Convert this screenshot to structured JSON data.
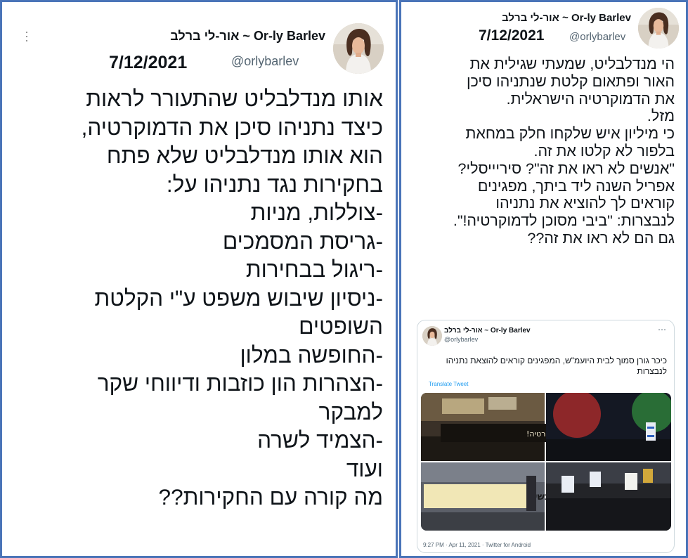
{
  "left_tweet": {
    "author_name": "אור-לי ברלב ~ Or-ly Barlev",
    "handle": "@orlybarlev",
    "date": "7/12/2021",
    "lines": [
      "אותו מנדלבליט שהתעורר לראות",
      "כיצד נתניהו סיכן את הדמוקרטיה,",
      "הוא אותו מנדלבליט שלא פתח",
      "בחקירות נגד נתניהו על:",
      "-צוללות, מניות",
      "-גריסת המסמכים",
      "-ריגול בבחירות",
      "-ניסיון שיבוש משפט ע\"י הקלטת",
      "השופטים",
      "-החופשה במלון",
      "-הצהרות הון כוזבות ודיווחי שקר",
      "למבקר",
      "-הצמיד לשרה",
      "ועוד",
      "מה קורה עם החקירות??"
    ]
  },
  "right_tweet": {
    "author_name": "אור-לי ברלב ~ Or-ly Barlev",
    "handle": "@orlybarlev",
    "date": "7/12/2021",
    "lines": [
      "הי מנדלבליט, שמעתי שגילית את",
      "האור ופתאום קלטת שנתניהו סיכן",
      "את הדמוקרטיה הישראלית.",
      "מזל.",
      "כי מיליון איש שלקחו חלק במחאת",
      "בלפור לא קלטו את זה.",
      "\"אנשים לא ראו את זה\"? סיריייסלי?",
      "אפריל השנה ליד ביתך, מפגינים",
      "קוראים לך להוציא את נתניהו",
      "לנבצרות: \"ביבי מסוכן לדמוקרטיה!\".",
      "גם הם לא ראו את זה??"
    ],
    "quoted": {
      "author_name": "אור-לי ברלב ~ Or-ly Barlev",
      "handle": "@orlybarlev",
      "text": "כיכר גורן סמוך לבית היועמ\"ש, המפגינים קוראים להוצאת נתניהו לנבצרות",
      "translate_label": "Translate Tweet",
      "photo_signs": [
        "ביבי מסוכן לדמוקרטיה!",
        "נבצרות עכשיו!"
      ],
      "footer": "9:27 PM · Apr 11, 2021 · Twitter for Android"
    }
  },
  "colors": {
    "frame": "#4a74b8",
    "secondary_text": "#536471",
    "link": "#1d9bf0"
  }
}
